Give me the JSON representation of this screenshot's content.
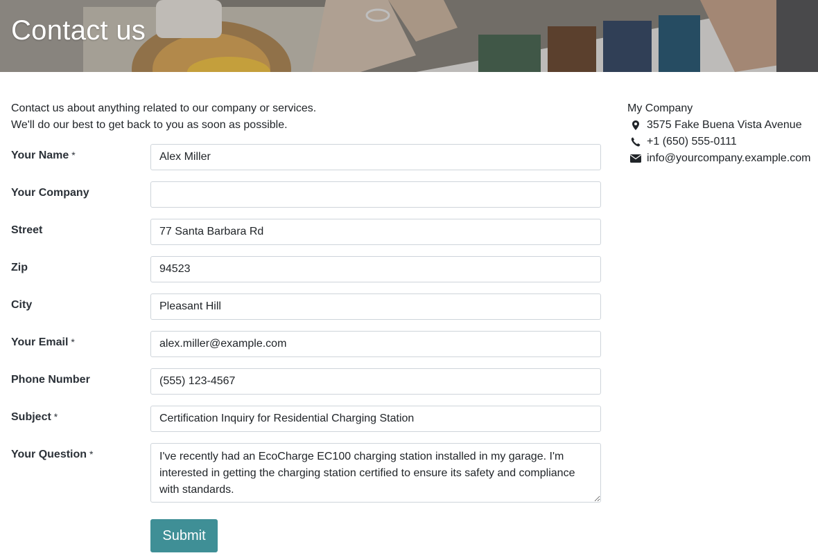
{
  "header": {
    "title": "Contact us"
  },
  "intro": {
    "line1": "Contact us about anything related to our company or services.",
    "line2": "We'll do our best to get back to you as soon as possible."
  },
  "form": {
    "required_mark": "*",
    "fields": {
      "name": {
        "label": "Your Name",
        "value": "Alex Miller",
        "required": true
      },
      "company": {
        "label": "Your Company",
        "value": "",
        "required": false
      },
      "street": {
        "label": "Street",
        "value": "77 Santa Barbara Rd",
        "required": false
      },
      "zip": {
        "label": "Zip",
        "value": "94523",
        "required": false
      },
      "city": {
        "label": "City",
        "value": "Pleasant Hill",
        "required": false
      },
      "email": {
        "label": "Your Email",
        "value": "alex.miller@example.com",
        "required": true
      },
      "phone": {
        "label": "Phone Number",
        "value": "(555) 123-4567",
        "required": false
      },
      "subject": {
        "label": "Subject",
        "value": "Certification Inquiry for Residential Charging Station",
        "required": true
      },
      "question": {
        "label": "Your Question",
        "value": "I've recently had an EcoCharge EC100 charging station installed in my garage. I'm interested in getting the charging station certified to ensure its safety and compliance with standards.",
        "required": true
      }
    },
    "submit_label": "Submit"
  },
  "company": {
    "name": "My Company",
    "address": "3575 Fake Buena Vista Avenue",
    "phone": "+1 (650) 555-0111",
    "email": "info@yourcompany.example.com",
    "icons": {
      "address": "map-marker-icon",
      "phone": "phone-icon",
      "email": "envelope-icon"
    }
  },
  "colors": {
    "accent": "#3f8f96",
    "text": "#212529",
    "input_border": "#ced4da"
  }
}
